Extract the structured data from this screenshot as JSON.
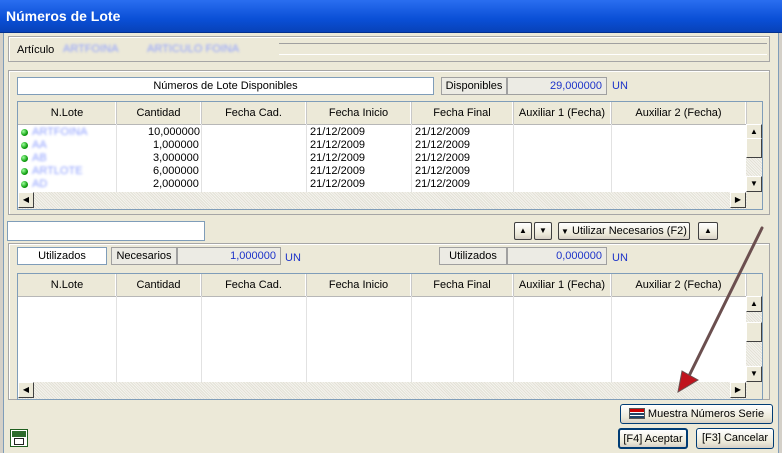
{
  "window": {
    "title": "Números de Lote"
  },
  "articulo": {
    "label": "Artículo",
    "code_blurred": "ARTFOINA",
    "desc_blurred": "ARTICULO FOINA"
  },
  "available": {
    "header_title": "Números de Lote Disponibles",
    "disponibles_label": "Disponibles",
    "disponibles_value": "29,000000",
    "unit": "UN",
    "columns": [
      "N.Lote",
      "Cantidad",
      "Fecha Cad.",
      "Fecha Inicio",
      "Fecha Final",
      "Auxiliar 1 (Fecha)",
      "Auxiliar 2 (Fecha)"
    ],
    "rows": [
      {
        "lote": "ARTFOINA",
        "cantidad": "10,000000",
        "cad": "",
        "inicio": "21/12/2009",
        "final": "21/12/2009"
      },
      {
        "lote": "AA",
        "cantidad": "1,000000",
        "cad": "",
        "inicio": "21/12/2009",
        "final": "21/12/2009"
      },
      {
        "lote": "AB",
        "cantidad": "3,000000",
        "cad": "",
        "inicio": "21/12/2009",
        "final": "21/12/2009"
      },
      {
        "lote": "ARTLOTE",
        "cantidad": "6,000000",
        "cad": "",
        "inicio": "21/12/2009",
        "final": "21/12/2009"
      },
      {
        "lote": "AD",
        "cantidad": "2,000000",
        "cad": "",
        "inicio": "21/12/2009",
        "final": "21/12/2009"
      }
    ]
  },
  "middle": {
    "search_value": "",
    "up_arrow": "▲",
    "down_arrow": "▼",
    "utilizar_label": "Utilizar Necesarios (F2)",
    "collapse_glyph": "▲"
  },
  "used": {
    "utilizados_tab": "Utilizados",
    "necesarios_label": "Necesarios",
    "necesarios_value": "1,000000",
    "unit": "UN",
    "utilizados_label": "Utilizados",
    "utilizados_value": "0,000000",
    "columns": [
      "N.Lote",
      "Cantidad",
      "Fecha Cad.",
      "Fecha Inicio",
      "Fecha Final",
      "Auxiliar 1 (Fecha)",
      "Auxiliar 2 (Fecha)"
    ]
  },
  "footer": {
    "muestra_label": "Muestra Números Serie",
    "aceptar_label": "[F4] Aceptar",
    "cancelar_label": "[F3] Cancelar"
  },
  "icons": {
    "corner": "excel-icon",
    "muestra": "list-icon"
  },
  "colors": {
    "title_bar": "#0a4fd6",
    "value_text": "#1d33c9",
    "annotation_arrow": "#6b4f4f"
  }
}
